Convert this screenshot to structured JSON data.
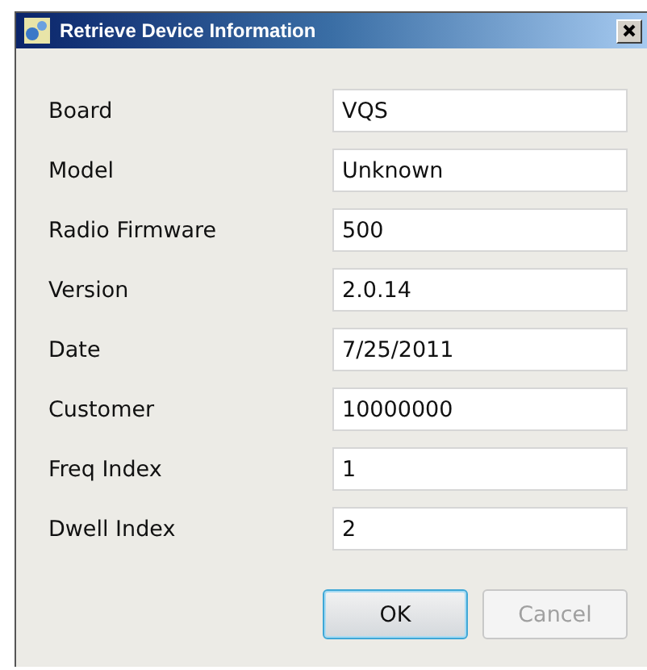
{
  "window": {
    "title": "Retrieve Device Information"
  },
  "fields": [
    {
      "label": "Board",
      "value": "VQS"
    },
    {
      "label": "Model",
      "value": "Unknown"
    },
    {
      "label": "Radio Firmware",
      "value": "500"
    },
    {
      "label": "Version",
      "value": "2.0.14"
    },
    {
      "label": "Date",
      "value": "7/25/2011"
    },
    {
      "label": "Customer",
      "value": "10000000"
    },
    {
      "label": "Freq Index",
      "value": "1"
    },
    {
      "label": "Dwell Index",
      "value": "2"
    }
  ],
  "buttons": [
    {
      "label": "OK",
      "disabled": false,
      "focused": true
    },
    {
      "label": "Cancel",
      "disabled": true,
      "focused": false
    }
  ]
}
